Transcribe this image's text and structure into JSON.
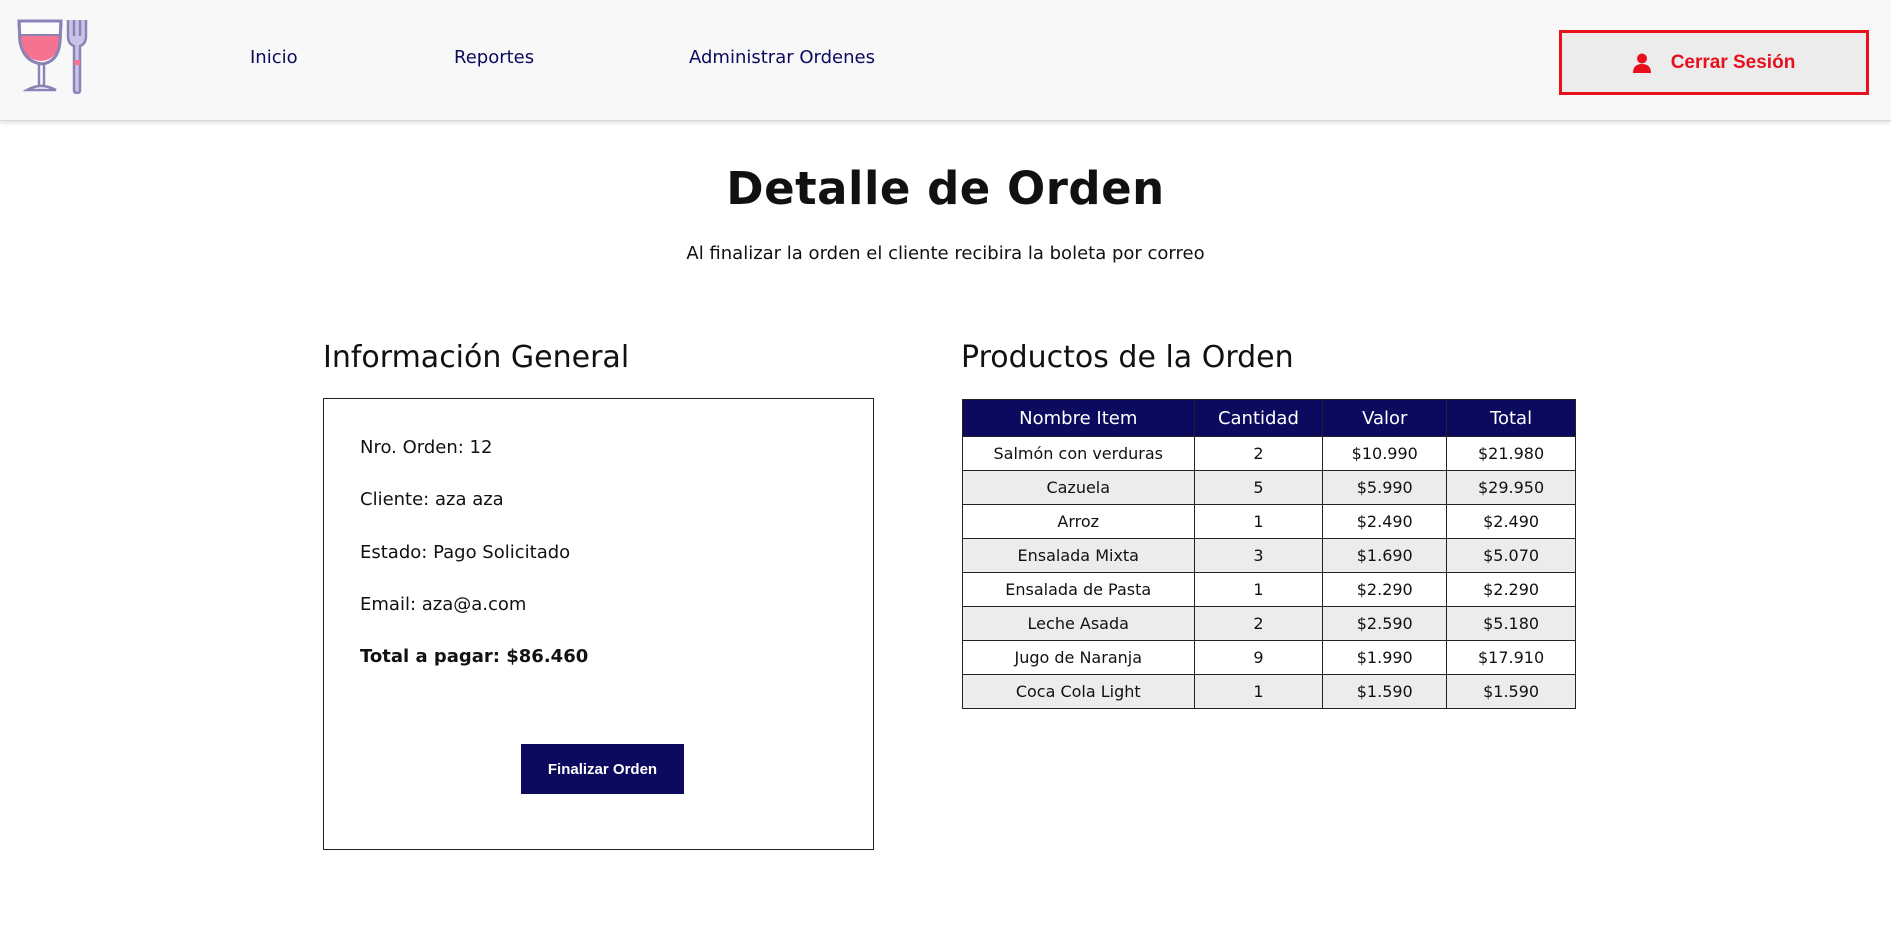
{
  "nav": {
    "logo_icon": "wine-glass-and-fork-icon",
    "links": [
      "Inicio",
      "Reportes",
      "Administrar Ordenes"
    ],
    "logout_label": "Cerrar Sesión",
    "logout_icon": "user-icon"
  },
  "page": {
    "title": "Detalle de Orden",
    "subtitle": "Al finalizar la orden el cliente recibira la boleta por correo"
  },
  "info": {
    "heading": "Información General",
    "order_number": "Nro. Orden: 12",
    "client": "Cliente: aza aza",
    "status": "Estado: Pago Solicitado",
    "email": "Email: aza@a.com",
    "total": "Total a pagar: $86.460",
    "finalize_label": "Finalizar Orden"
  },
  "products": {
    "heading": "Productos de la Orden",
    "columns": [
      "Nombre Item",
      "Cantidad",
      "Valor",
      "Total"
    ],
    "rows": [
      [
        "Salmón con verduras",
        "2",
        "$10.990",
        "$21.980"
      ],
      [
        "Cazuela",
        "5",
        "$5.990",
        "$29.950"
      ],
      [
        "Arroz",
        "1",
        "$2.490",
        "$2.490"
      ],
      [
        "Ensalada Mixta",
        "3",
        "$1.690",
        "$5.070"
      ],
      [
        "Ensalada de Pasta",
        "1",
        "$2.290",
        "$2.290"
      ],
      [
        "Leche Asada",
        "2",
        "$2.590",
        "$5.180"
      ],
      [
        "Jugo de Naranja",
        "9",
        "$1.990",
        "$17.910"
      ],
      [
        "Coca Cola Light",
        "1",
        "$1.590",
        "$1.590"
      ]
    ]
  },
  "colors": {
    "primary": "#0c0a5e",
    "danger": "#e8101c",
    "zebra": "#ececec"
  }
}
